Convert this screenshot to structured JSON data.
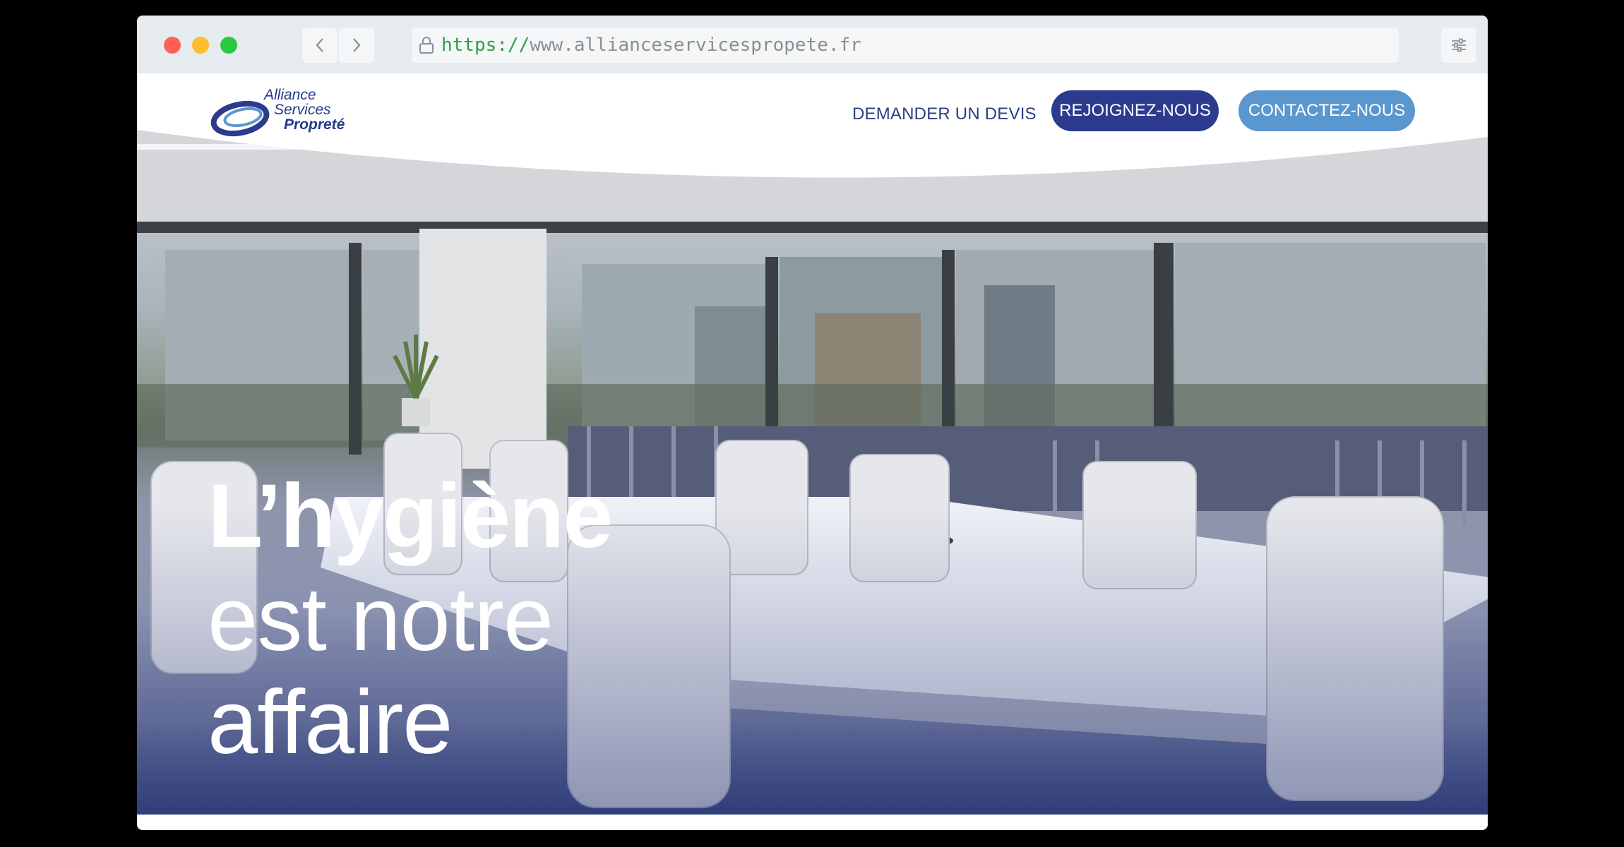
{
  "browser": {
    "url_scheme": "https://",
    "url_host": "www.allianceservicespropete.fr"
  },
  "logo": {
    "line1": "Alliance",
    "line2": "Services",
    "line3": "Propreté"
  },
  "nav": {
    "quote_link": "DEMANDER UN DEVIS",
    "join_button": "REJOIGNEZ-NOUS",
    "contact_button": "CONTACTEZ-NOUS"
  },
  "hero": {
    "headline_bold": "L’hygiène",
    "headline_line2": "est notre",
    "headline_line3": "affaire"
  },
  "colors": {
    "brand_dark": "#2c3b8e",
    "brand_light": "#5b97cf",
    "nav_text": "#2c3e86"
  }
}
